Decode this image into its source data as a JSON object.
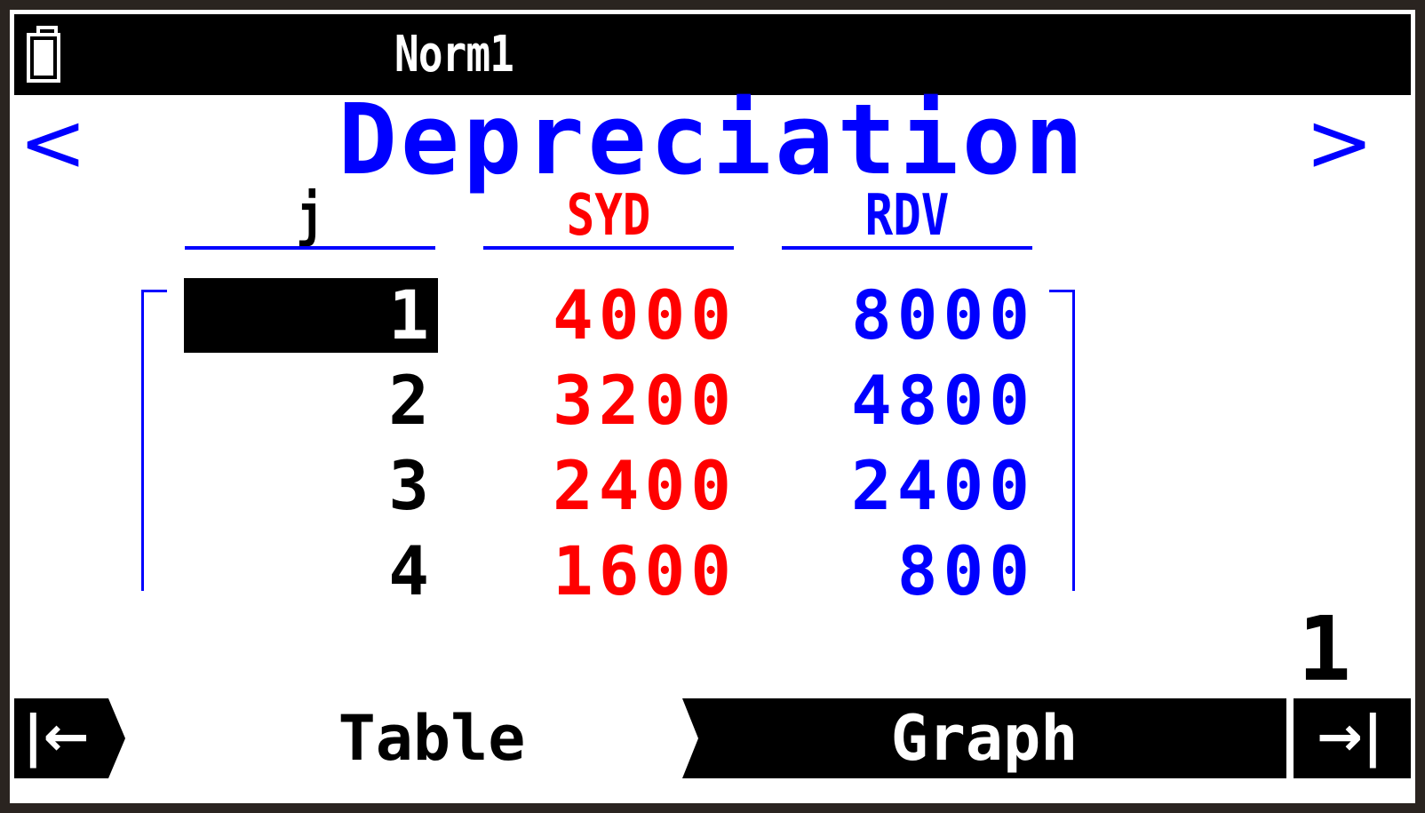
{
  "status_bar": {
    "mode": "Norm1",
    "battery_icon": "battery-icon"
  },
  "header": {
    "title": "Depreciation",
    "prev_arrow": "<",
    "next_arrow": ">"
  },
  "table": {
    "columns": [
      {
        "label": "j",
        "color": "#000000"
      },
      {
        "label": "SYD",
        "color": "#ff0000"
      },
      {
        "label": "RDV",
        "color": "#0000ff"
      }
    ],
    "rows": [
      {
        "j": "1",
        "syd": "4000",
        "rdv": "8000"
      },
      {
        "j": "2",
        "syd": "3200",
        "rdv": "4800"
      },
      {
        "j": "3",
        "syd": "2400",
        "rdv": "2400"
      },
      {
        "j": "4",
        "syd": "1600",
        "rdv": "800"
      }
    ],
    "selected_cell": "row 1, column j",
    "current_row_indicator": "1"
  },
  "function_bar": {
    "back_icon": "|←",
    "table_label": "Table",
    "graph_label": "Graph",
    "next_icon": "→|"
  },
  "colors": {
    "accent_blue": "#0000ff",
    "accent_red": "#ff0000",
    "bar_black": "#000000"
  }
}
